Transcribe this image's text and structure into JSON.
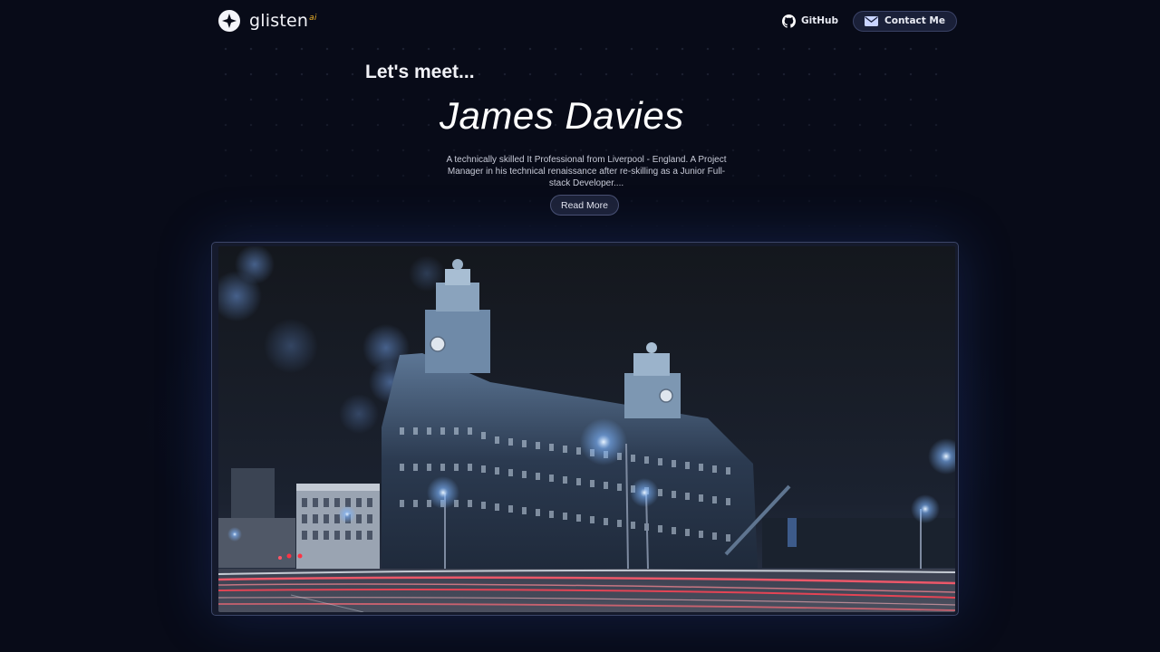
{
  "header": {
    "brand_name": "glisten",
    "brand_suffix": "ai",
    "github_label": "GitHub",
    "contact_label": "Contact Me"
  },
  "hero": {
    "intro": "Let's meet...",
    "name": "James Davies",
    "bio": "A technically skilled It Professional from Liverpool - England. A Project Manager in his technical renaissance after re-skilling as a Junior Full-stack Developer....",
    "cta_label": "Read More"
  },
  "image": {
    "subject": "Royal Liver Building at night with light trails"
  },
  "colors": {
    "background": "#080b18",
    "accent": "#f0b429",
    "button_bg": "#1a2038",
    "border": "#3a4266"
  }
}
